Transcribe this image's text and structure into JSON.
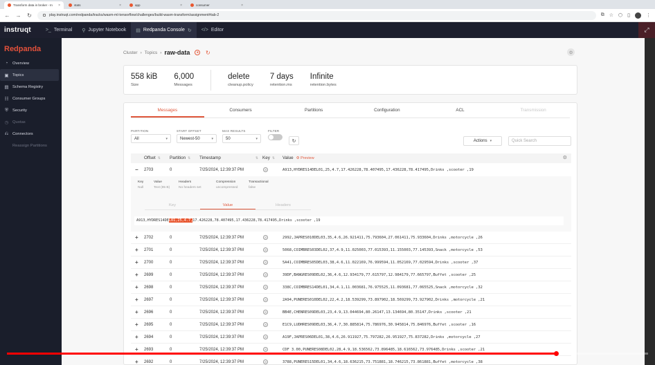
{
  "browser": {
    "tabs": [
      {
        "label": "Transform data in broker - In",
        "active": true
      },
      {
        "label": "stats",
        "active": false
      },
      {
        "label": "app",
        "active": false
      },
      {
        "label": "consumer",
        "active": false
      }
    ],
    "url": "play.instruqt.com/redpanda/tracks/wasm-ml-tensorflow/challenges/build-wasm-transform/assignment#tab-2"
  },
  "instruqt": {
    "logo": "instruqt",
    "tabs": [
      {
        "label": "Terminal",
        "icon": ">_",
        "active": false
      },
      {
        "label": "Jupyter Notebook",
        "icon": "⚲",
        "active": false
      },
      {
        "label": "Redpanda Console",
        "icon": "▤",
        "active": true
      },
      {
        "label": "Editor",
        "icon": "</>",
        "active": false
      }
    ]
  },
  "sidebar": {
    "brand": "Redpanda",
    "items": [
      {
        "label": "Overview",
        "icon": "◔",
        "active": false,
        "disabled": false
      },
      {
        "label": "Topics",
        "icon": "▣",
        "active": true,
        "disabled": false
      },
      {
        "label": "Schema Registry",
        "icon": "▤",
        "active": false,
        "disabled": false
      },
      {
        "label": "Consumer Groups",
        "icon": "☷",
        "active": false,
        "disabled": false
      },
      {
        "label": "Security",
        "icon": "⛨",
        "active": false,
        "disabled": false
      },
      {
        "label": "Quotas",
        "icon": "◷",
        "active": false,
        "disabled": true
      },
      {
        "label": "Connectors",
        "icon": "⎌",
        "active": false,
        "disabled": false
      },
      {
        "label": "Reassign Partitions",
        "icon": "",
        "active": false,
        "disabled": true
      }
    ]
  },
  "breadcrumb": {
    "cluster": "Cluster",
    "topics": "Topics",
    "current": "raw-data"
  },
  "stats": [
    {
      "value": "558 kiB",
      "label": "Size"
    },
    {
      "value": "6,000",
      "label": "Messages"
    },
    {
      "value": "delete",
      "label": "cleanup.policy"
    },
    {
      "value": "7 days",
      "label": "retention.ms"
    },
    {
      "value": "Infinite",
      "label": "retention.bytes"
    }
  ],
  "topic_tabs": [
    {
      "label": "Messages",
      "active": true,
      "disabled": false
    },
    {
      "label": "Consumers",
      "active": false,
      "disabled": false
    },
    {
      "label": "Partitions",
      "active": false,
      "disabled": false
    },
    {
      "label": "Configuration",
      "active": false,
      "disabled": false
    },
    {
      "label": "ACL",
      "active": false,
      "disabled": false
    },
    {
      "label": "Transmission",
      "active": false,
      "disabled": true
    }
  ],
  "filters": {
    "partition": {
      "label": "PARTITION",
      "value": "All"
    },
    "start_offset": {
      "label": "START OFFSET",
      "value": "Newest-50"
    },
    "max_results": {
      "label": "MAX RESULTS",
      "value": "50"
    },
    "filter": {
      "label": "FILTER"
    },
    "actions_label": "Actions",
    "search_placeholder": "Quick Search"
  },
  "table": {
    "headers": {
      "offset": "Offset",
      "partition": "Partition",
      "timestamp": "Timestamp",
      "key": "Key",
      "value": "Value",
      "preview": "Preview"
    },
    "expanded_row": {
      "offset": "2703",
      "partition": "0",
      "timestamp": "7/25/2024, 12:39:37 PM",
      "value": "A913,HYDRES14DEL01,25,4.7,17.426228,78.407495,17.436228,78.417495,Drinks ,scooter ,19"
    },
    "meta": [
      {
        "label": "Key",
        "value": "Null"
      },
      {
        "label": "Value",
        "value": "Text (85 B)"
      },
      {
        "label": "Headers",
        "value": "No headers set"
      },
      {
        "label": "Compression",
        "value": "uncompressed"
      },
      {
        "label": "Transactional",
        "value": "false"
      }
    ],
    "detail_tabs": [
      {
        "label": "Key",
        "active": false
      },
      {
        "label": "Value",
        "active": true
      },
      {
        "label": "Headers",
        "active": false
      }
    ],
    "raw_value": {
      "before": "A913,HYDRES14DE",
      "highlight": "L01,25,4.7,",
      "after": "17.426228,78.407495,17.436228,78.417495,Drinks ,scooter ,19"
    },
    "rows": [
      {
        "offset": "2702",
        "partition": "0",
        "timestamp": "7/25/2024, 12:39:37 PM",
        "value": "2992,JAPRES010DEL03,35,4.6,26.921411,75.793604,27.061411,75.933604,Drinks ,motorcycle ,26"
      },
      {
        "offset": "2701",
        "partition": "0",
        "timestamp": "7/25/2024, 12:39:37 PM",
        "value": "5068,COIMBRES03DEL02,37,4.9,11.025003,77.015393,11.155003,77.145393,Snack ,motorcycle ,53"
      },
      {
        "offset": "2700",
        "partition": "0",
        "timestamp": "7/25/2024, 12:39:37 PM",
        "value": "5A41,COIMBRES05DEL03,38,4.6,11.022169,76.999594,11.052169,77.029594,Drinks ,scooter ,37"
      },
      {
        "offset": "2699",
        "partition": "0",
        "timestamp": "7/25/2024, 12:39:37 PM",
        "value": "39DF,BANGRES09DEL02,36,4.6,12.934179,77.615797,12.984179,77.665797,Buffet ,scooter ,25"
      },
      {
        "offset": "2698",
        "partition": "0",
        "timestamp": "7/25/2024, 12:39:37 PM",
        "value": "338C,COIMBRES14DEL01,34,4.1,11.003681,76.975525,11.093681,77.065525,Snack ,motorcycle ,32"
      },
      {
        "offset": "2697",
        "partition": "0",
        "timestamp": "7/25/2024, 12:39:37 PM",
        "value": "2A94,PUNERES010DEL02,22,4.2,18.539299,73.897902,18.569299,73.927902,Drinks ,motorcycle ,21"
      },
      {
        "offset": "2696",
        "partition": "0",
        "timestamp": "7/25/2024, 12:39:37 PM",
        "value": "BB4E,CHENRES09DEL03,23,4.9,13.044694,80.26147,13.134694,80.35147,Drinks ,scooter ,21"
      },
      {
        "offset": "2695",
        "partition": "0",
        "timestamp": "7/25/2024, 12:39:37 PM",
        "value": "E1C9,LUDHRES09DEL03,36,4.7,30.885814,75.786976,30.945814,75.846976,Buffet ,scooter ,16"
      },
      {
        "offset": "2694",
        "partition": "0",
        "timestamp": "7/25/2024, 12:39:37 PM",
        "value": "A19F,JAPRES06DEL01,38,4.6,26.911927,75.797282,26.951927,75.837282,Drinks ,motorcycle ,27"
      },
      {
        "offset": "2693",
        "partition": "0",
        "timestamp": "7/25/2024, 12:39:37 PM",
        "value": "CDF 3.00,PUNERES08DEL02,28,4.9,18.536562,73.896485,18.616562,73.976485,Drinks ,scooter ,21"
      },
      {
        "offset": "2692",
        "partition": "0",
        "timestamp": "7/25/2024, 12:39:37 PM",
        "value": "3788,PUNERES15DEL01,34,4.6,18.636215,73.751881,18.746215,73.861881,Buffet ,motorcycle ,38"
      }
    ]
  },
  "video": {
    "progress_fraction": 0.856
  },
  "colors": {
    "accent": "#e0583c",
    "sidebar_bg": "#1a1e2b",
    "instruqt_bg": "#1d1f2e",
    "highlight": "#e8562f",
    "progress": "#ff0000"
  }
}
